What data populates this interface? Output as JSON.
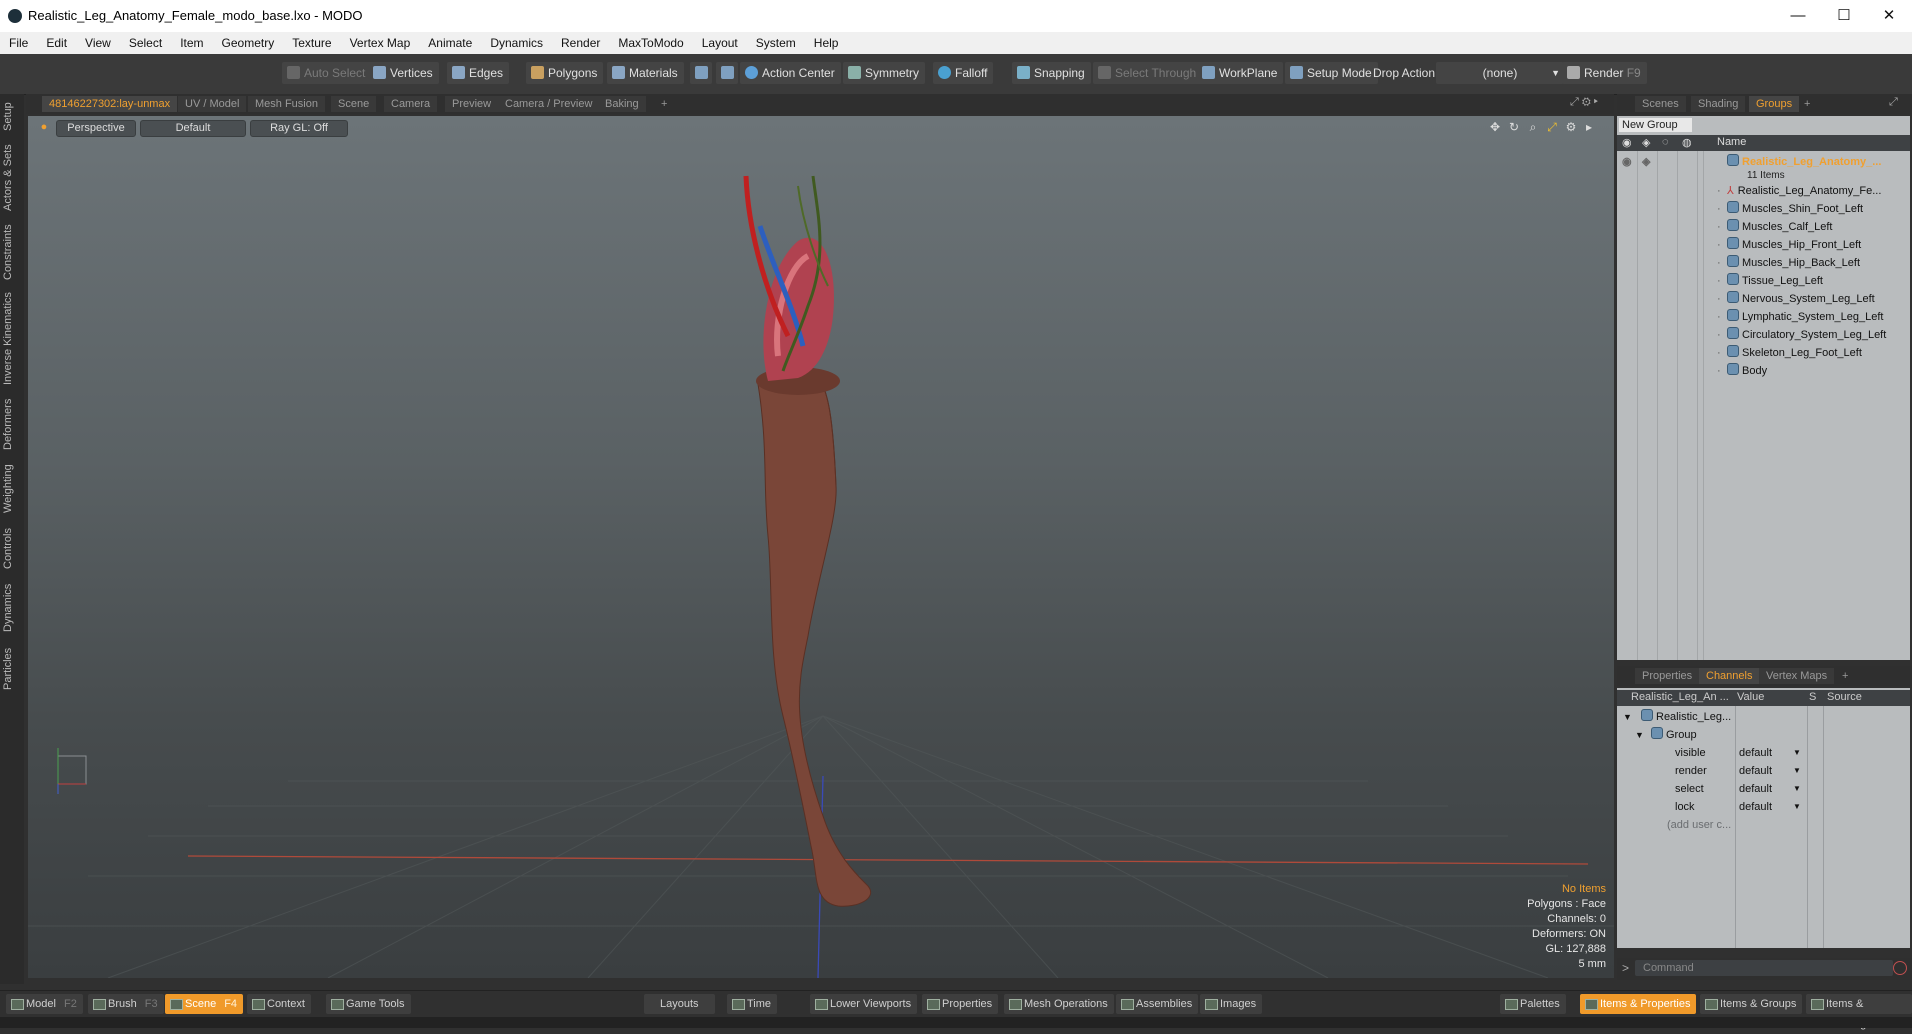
{
  "window": {
    "title": "Realistic_Leg_Anatomy_Female_modo_base.lxo - MODO",
    "min": "—",
    "max": "☐",
    "close": "✕"
  },
  "menu": [
    "File",
    "Edit",
    "View",
    "Select",
    "Item",
    "Geometry",
    "Texture",
    "Vertex Map",
    "Animate",
    "Dynamics",
    "Render",
    "MaxToModo",
    "Layout",
    "System",
    "Help"
  ],
  "toolbar": {
    "auto_select": "Auto Select",
    "vertices": "Vertices",
    "edges": "Edges",
    "polygons": "Polygons",
    "materials": "Materials",
    "action_center": "Action Center",
    "symmetry": "Symmetry",
    "falloff": "Falloff",
    "snapping": "Snapping",
    "select_through": "Select Through",
    "workplane": "WorkPlane",
    "setup_mode": "Setup Mode",
    "drop_action_label": "Drop Action",
    "drop_action_value": "(none)",
    "render": "Render",
    "render_key": "F9"
  },
  "left_tabs": [
    "Setup",
    "Actors & Sets",
    "Constraints",
    "Inverse Kinematics",
    "Deformers",
    "Weighting",
    "Controls",
    "Dynamics",
    "Particles"
  ],
  "viewport_tabs": [
    "48146227302:lay-unmax",
    "UV / Model",
    "Mesh Fusion",
    "Scene",
    "Camera",
    "Preview",
    "Camera / Preview",
    "Baking",
    "+"
  ],
  "viewport": {
    "view": "Perspective",
    "shading": "Default",
    "raygl": "Ray GL: Off",
    "info": {
      "selection": "No Items",
      "polygons": "Polygons : Face",
      "channels": "Channels: 0",
      "deformers": "Deformers: ON",
      "gl": "GL: 127,888",
      "scale": "5 mm"
    }
  },
  "right_tabs": [
    "Scenes",
    "Shading",
    "Groups",
    "+"
  ],
  "groups": {
    "new_group": "New Group",
    "name_header": "Name",
    "root_name": "Realistic_Leg_Anatomy_...",
    "root_count": "11 Items",
    "items": [
      "Realistic_Leg_Anatomy_Fe...",
      "Muscles_Shin_Foot_Left",
      "Muscles_Calf_Left",
      "Muscles_Hip_Front_Left",
      "Muscles_Hip_Back_Left",
      "Tissue_Leg_Left",
      "Nervous_System_Leg_Left",
      "Lymphatic_System_Leg_Left",
      "Circulatory_System_Leg_Left",
      "Skeleton_Leg_Foot_Left",
      "Body"
    ]
  },
  "channel_tabs": [
    "Properties",
    "Channels",
    "Vertex Maps",
    "+"
  ],
  "channels": {
    "headers": [
      "Realistic_Leg_An ...",
      "Value",
      "S",
      "Source"
    ],
    "root": "Realistic_Leg...",
    "group": "Group",
    "rows": [
      {
        "name": "visible",
        "value": "default"
      },
      {
        "name": "render",
        "value": "default"
      },
      {
        "name": "select",
        "value": "default"
      },
      {
        "name": "lock",
        "value": "default"
      }
    ],
    "add_user": "(add user c..."
  },
  "command": {
    "prompt": ">",
    "placeholder": "Command"
  },
  "bottom": {
    "left": [
      {
        "label": "Model",
        "key": "F2"
      },
      {
        "label": "Brush",
        "key": "F3"
      },
      {
        "label": "Scene",
        "key": "F4"
      },
      {
        "label": "Context",
        "key": ""
      },
      {
        "label": "Game Tools",
        "key": ""
      }
    ],
    "center": [
      "Layouts",
      "Time",
      "Lower Viewports",
      "Properties",
      "Mesh Operations",
      "Assemblies",
      "Images"
    ],
    "right": [
      "Palettes",
      "Items & Properties",
      "Items & Groups",
      "Items & Shading"
    ]
  },
  "colors": {
    "accent": "#f0a030",
    "active_tab": "#f09a2a",
    "viewport_top": "#6c7478",
    "panel_bg": "#b9bcbe"
  }
}
